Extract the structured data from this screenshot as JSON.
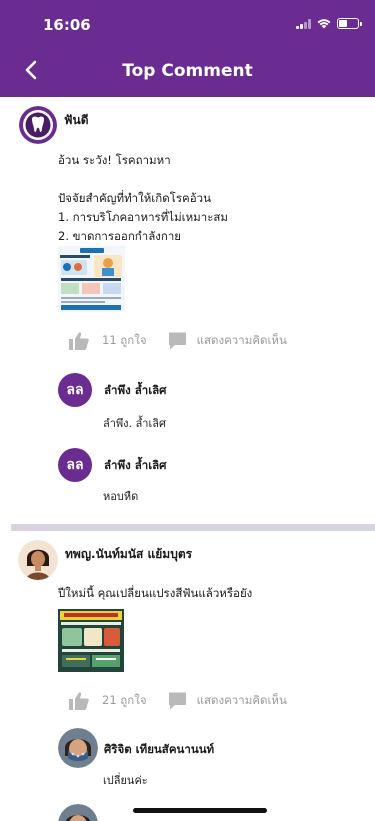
{
  "status_bar": {
    "time": "16:06"
  },
  "nav": {
    "title": "Top Comment"
  },
  "posts": [
    {
      "poster": "ฟันดี",
      "text": "อ้วน ระวัง! โรคถามหา\n\nปัจจัยสำคัญที่ทำให้เกิดโรคอ้วน\n1. การบริโภคอาหารที่ไม่เหมาะสม\n2. ขาดการออกกำลังกาย",
      "likes": "11 ถูกใจ",
      "comment_label": "แสดงความคิดเห็น",
      "replies": [
        {
          "initials": "ลล",
          "name": "ลำพึง ล้ำเลิศ",
          "text": "ลำพึง. ล้ำเลิศ"
        },
        {
          "initials": "ลล",
          "name": "ลำพึง ล้ำเลิศ",
          "text": "หอบหืด"
        }
      ]
    },
    {
      "poster": "ทพญ.นันท์มนัส แย้มบุตร",
      "text": "ปีใหม่นี้ คุณเปลี่ยนแปรงสีฟันแล้วหรือยัง",
      "likes": "21 ถูกใจ",
      "comment_label": "แสดงความคิดเห็น",
      "replies": [
        {
          "name": "ศิริจิต เทียนสัคนานนท์",
          "text": "เปลี่ยนค่ะ"
        }
      ]
    }
  ],
  "colors": {
    "brand": "#6a2c91",
    "muted": "#9a9a9a",
    "divider": "#d9d3e0"
  }
}
